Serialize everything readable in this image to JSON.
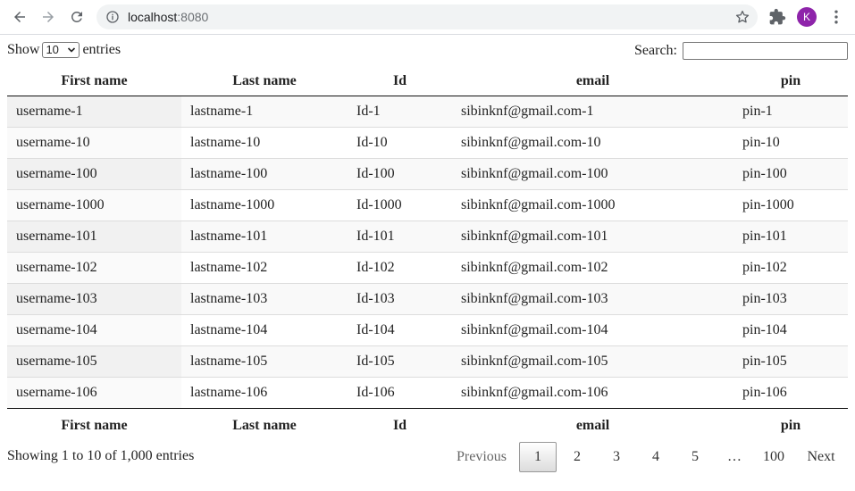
{
  "browser": {
    "url_host": "localhost",
    "url_port": ":8080",
    "profile_initial": "K"
  },
  "controls": {
    "show_label": "Show",
    "length_value": "10",
    "entries_label": "entries",
    "search_label": "Search:",
    "search_value": ""
  },
  "table": {
    "columns": [
      "First name",
      "Last name",
      "Id",
      "email",
      "pin"
    ],
    "rows": [
      [
        "username-1",
        "lastname-1",
        "Id-1",
        "sibinknf@gmail.com-1",
        "pin-1"
      ],
      [
        "username-10",
        "lastname-10",
        "Id-10",
        "sibinknf@gmail.com-10",
        "pin-10"
      ],
      [
        "username-100",
        "lastname-100",
        "Id-100",
        "sibinknf@gmail.com-100",
        "pin-100"
      ],
      [
        "username-1000",
        "lastname-1000",
        "Id-1000",
        "sibinknf@gmail.com-1000",
        "pin-1000"
      ],
      [
        "username-101",
        "lastname-101",
        "Id-101",
        "sibinknf@gmail.com-101",
        "pin-101"
      ],
      [
        "username-102",
        "lastname-102",
        "Id-102",
        "sibinknf@gmail.com-102",
        "pin-102"
      ],
      [
        "username-103",
        "lastname-103",
        "Id-103",
        "sibinknf@gmail.com-103",
        "pin-103"
      ],
      [
        "username-104",
        "lastname-104",
        "Id-104",
        "sibinknf@gmail.com-104",
        "pin-104"
      ],
      [
        "username-105",
        "lastname-105",
        "Id-105",
        "sibinknf@gmail.com-105",
        "pin-105"
      ],
      [
        "username-106",
        "lastname-106",
        "Id-106",
        "sibinknf@gmail.com-106",
        "pin-106"
      ]
    ]
  },
  "footer": {
    "info": "Showing 1 to 10 of 1,000 entries",
    "pager": {
      "previous": "Previous",
      "pages": [
        "1",
        "2",
        "3",
        "4",
        "5"
      ],
      "ellipsis": "…",
      "last": "100",
      "next": "Next",
      "current": "1"
    }
  }
}
